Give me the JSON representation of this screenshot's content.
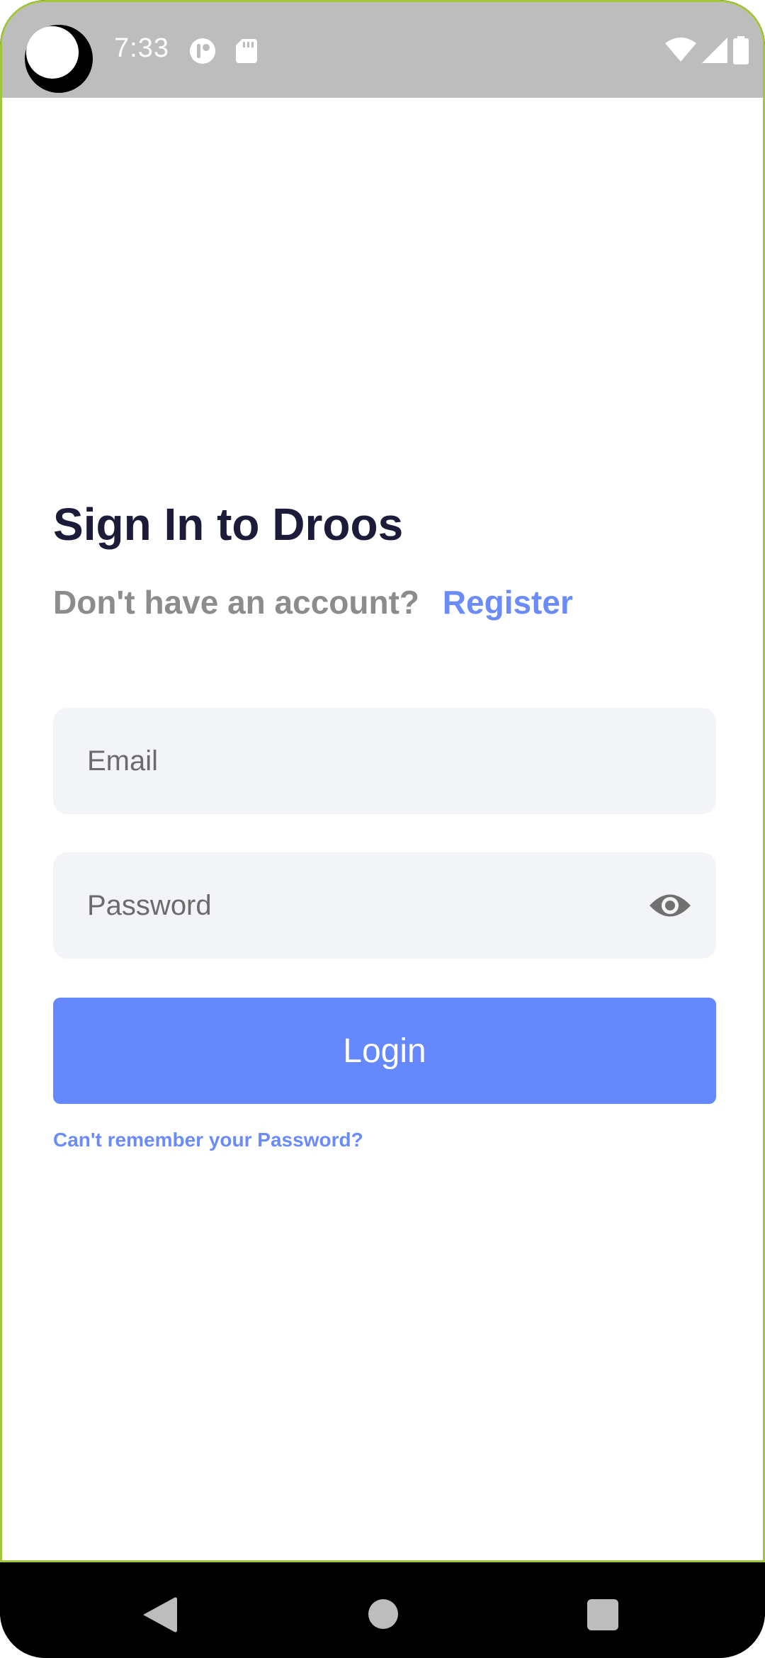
{
  "status_bar": {
    "time": "7:33",
    "icons": [
      "camera-cutout",
      "app-notification-icon",
      "sd-card-icon",
      "wifi-icon",
      "cell-signal-icon",
      "battery-icon"
    ]
  },
  "login": {
    "title": "Sign In to Droos",
    "no_account_text": "Don't have an account?",
    "register_label": "Register",
    "email_placeholder": "Email",
    "password_placeholder": "Password",
    "login_label": "Login",
    "forgot_password_label": "Can't remember your Password?"
  },
  "nav_bar": {
    "icons": [
      "back-icon",
      "home-icon",
      "recents-icon"
    ]
  },
  "colors": {
    "accent": "#6688fd",
    "link": "#6b8bf9",
    "title": "#1c1b3a",
    "muted_text": "#8c8c8c",
    "input_bg": "#f3f4f8",
    "status_bar_bg": "#bdbdbd"
  }
}
